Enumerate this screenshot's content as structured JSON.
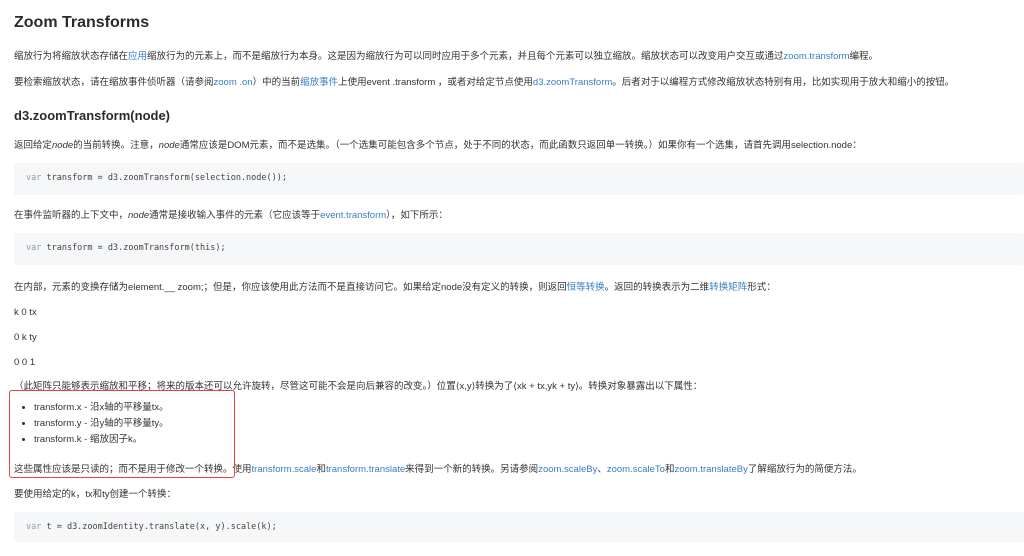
{
  "title": "Zoom Transforms",
  "intro": {
    "p1": {
      "pre": "缩放行为将缩放状态存储在",
      "link1": "应用",
      "mid": "缩放行为的元素上，而不是缩放行为本身。这是因为缩放行为可以同时应用于多个元素，并且每个元素可以独立缩放。缩放状态可以改变用户交互或通过",
      "link2": "zoom.transform",
      "post": "编程。"
    },
    "p2": {
      "pre": "要检索缩放状态，请在缩放事件侦听器（请参阅",
      "link1": "zoom .on",
      "mid1": "）中的当前",
      "link2": "缩放事件",
      "mid2": "上使用event .transform ，或者对给定节点使用",
      "link3": "d3.zoomTransform",
      "post": "。后者对于以编程方式修改缩放状态特别有用，比如实现用于放大和缩小的按钮。"
    }
  },
  "section_title": "d3.zoomTransform(node)",
  "desc1": {
    "pre": "返回给定",
    "em1": "node",
    "mid": "的当前转换。注意，",
    "em2": "node",
    "post": "通常应该是DOM元素，而不是选集。（一个选集可能包含多个节点，处于不同的状态，而此函数只返回单一转换。）如果你有一个选集，请首先调用selection.node："
  },
  "code1": {
    "kw": "var",
    "text": " transform = d3.zoomTransform(selection.node());"
  },
  "desc2": {
    "pre": "在事件监听器的上下文中，",
    "em": "node",
    "mid": "通常是接收输入事件的元素（它应该等于",
    "link": "event.transform",
    "post": "），如下所示："
  },
  "code2": {
    "kw": "var",
    "text": " transform = d3.zoomTransform(this);"
  },
  "desc3": {
    "pre": "在内部，元素的变换存储为element.__ zoom;；但是，你应该使用此方法而不是直接访问它。如果给定node没有定义的转换，则返回",
    "link1": "恒等转换",
    "mid": "。返回的转换表示为二维",
    "link2": "转换矩阵",
    "post": "形式："
  },
  "matrix": [
    "k 0 tx",
    "0 k ty",
    "0 0 1"
  ],
  "desc4": "（此矩阵只能够表示缩放和平移；将来的版本还可以允许旋转，尽管这可能不会是向后兼容的改变。）位置⟨x,y⟩转换为了⟨xk + tx,yk + ty⟩。转换对象暴露出以下属性：",
  "properties": [
    "transform.x - 沿x轴的平移量tx。",
    "transform.y - 沿y轴的平移量ty。",
    "transform.k - 缩放因子k。"
  ],
  "desc5": {
    "pre": "这些属性应该是只读的；而不是用于修改一个转换。使用",
    "link1": "transform.scale",
    "and1": "和",
    "link2": "transform.translate",
    "mid": "来得到一个新的转换。另请参阅",
    "link3": "zoom.scaleBy",
    "sep": "、",
    "link4": "zoom.scaleTo",
    "and2": "和",
    "link5": "zoom.translateBy",
    "post": "了解缩放行为的简便方法。"
  },
  "desc6": "要使用给定的k，tx和ty创建一个转换：",
  "code3": {
    "kw": "var",
    "text": " t = d3.zoomIdentity.translate(x, y).scale(k);"
  },
  "colors": {
    "link": "#3a7cc7",
    "highlight": "#e0493a",
    "code_bg": "#f6f7f9"
  }
}
